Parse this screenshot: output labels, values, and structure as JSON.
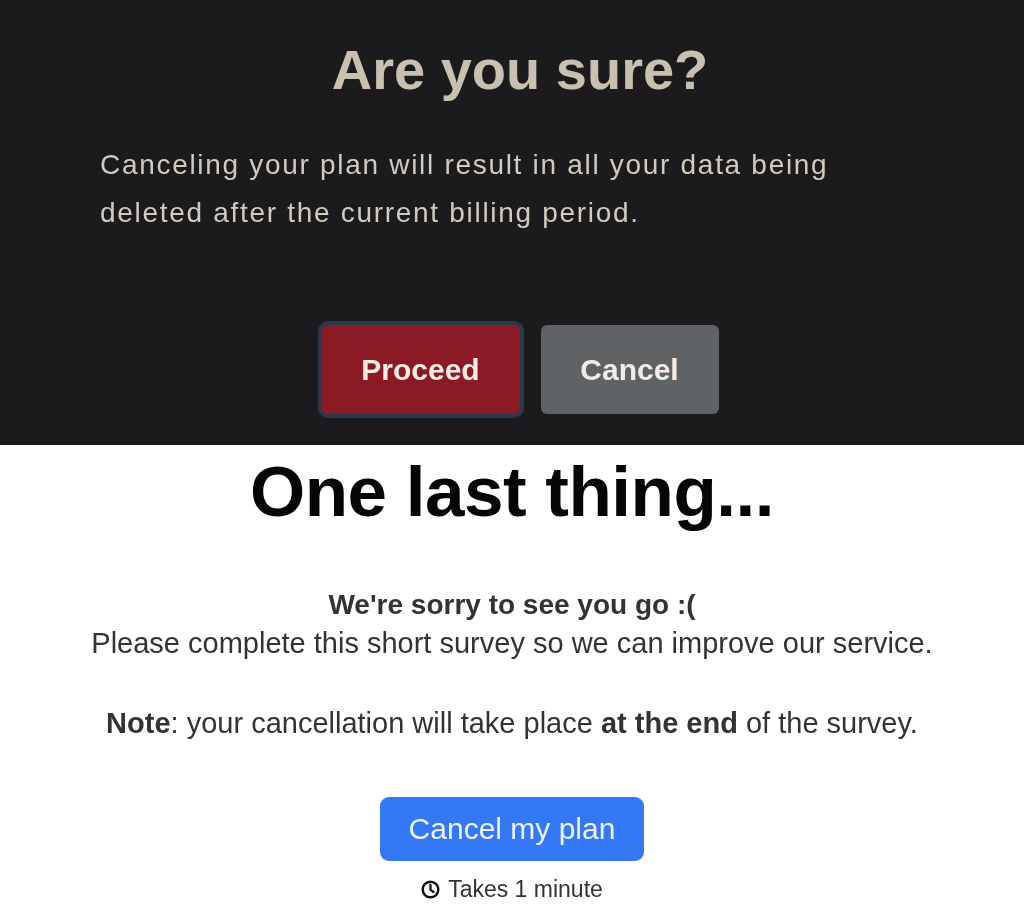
{
  "dialog": {
    "title": "Are you sure?",
    "message": "Canceling your plan will result in all your data being deleted after the current billing period.",
    "buttons": [
      {
        "label": "Proceed",
        "kind": "danger",
        "focused": true
      },
      {
        "label": "Cancel",
        "kind": "secondary",
        "focused": false
      }
    ]
  },
  "survey": {
    "title": "One last thing...",
    "subtitle": "We're sorry to see you go :(",
    "text": "Please complete this short survey so we can improve our service.",
    "note": "**Note**: your cancellation will take place **at the end** of the survey.",
    "button": "Cancel my plan",
    "duration": "Takes 1 minute"
  }
}
